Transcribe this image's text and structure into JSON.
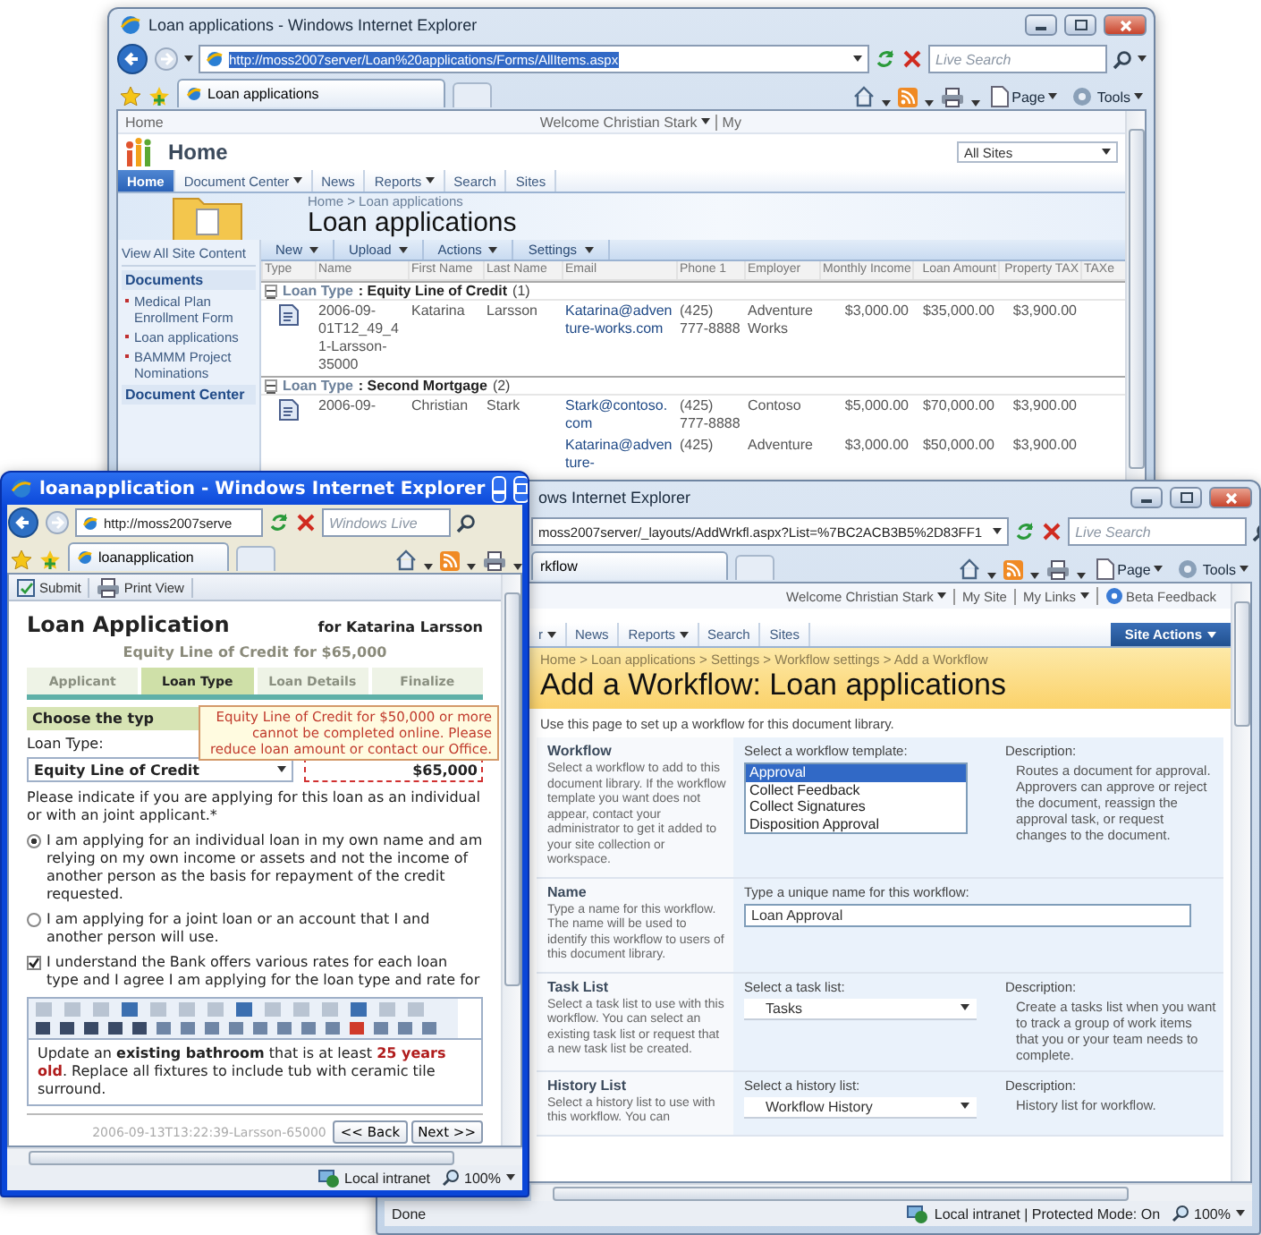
{
  "list_window": {
    "title": "Loan applications - Windows Internet Explorer",
    "address": "http://moss2007server/Loan%20applications/Forms/AllItems.aspx",
    "search_placeholder": "Live Search",
    "tab": "Loan applications",
    "commands": [
      "Page",
      "Tools"
    ],
    "top_link": "Home",
    "welcome": "Welcome Christian Stark",
    "my_link": "My",
    "site_title": "Home",
    "scope": "All Sites",
    "nav": [
      {
        "label": "Home",
        "selected": true,
        "menu": false
      },
      {
        "label": "Document Center",
        "selected": false,
        "menu": true
      },
      {
        "label": "News",
        "selected": false,
        "menu": false
      },
      {
        "label": "Reports",
        "selected": false,
        "menu": true
      },
      {
        "label": "Search",
        "selected": false,
        "menu": false
      },
      {
        "label": "Sites",
        "selected": false,
        "menu": false
      }
    ],
    "breadcrumb": "Home > Loan applications",
    "page_title": "Loan applications",
    "quick_launch": {
      "view_all": "View All Site Content",
      "sections": [
        {
          "heading": "Documents",
          "items": [
            "Medical Plan Enrollment Form",
            "Loan applications",
            "BAMMM Project Nominations"
          ]
        },
        {
          "heading": "Document Center"
        }
      ]
    },
    "list_toolbar": [
      "New",
      "Upload",
      "Actions",
      "Settings"
    ],
    "columns": [
      "Type",
      "Name",
      "First Name",
      "Last Name",
      "Email",
      "Phone 1",
      "Employer",
      "Monthly Income",
      "Loan Amount",
      "Property TAX",
      "TAXe"
    ],
    "groups": [
      {
        "field": "Loan Type",
        "value": ": Equity Line of Credit",
        "count": "(1)",
        "rows": [
          {
            "type_icon": true,
            "cells": [
              "2006-09-01T12_49_41-Larsson-35000",
              "Katarina",
              "Larsson",
              "Katarina@adventure-works.com",
              "(425) 777-8888",
              "Adventure Works",
              "$3,000.00",
              "$35,000.00",
              "$3,900.00"
            ]
          }
        ]
      },
      {
        "field": "Loan Type",
        "value": ": Second Mortgage",
        "count": "(2)",
        "rows": [
          {
            "type_icon": true,
            "cells": [
              "2006-09-",
              "Christian",
              "Stark",
              "Stark@contoso.com",
              "(425) 777-8888",
              "Contoso",
              "$5,000.00",
              "$70,000.00",
              "$3,900.00"
            ]
          },
          {
            "type_icon": false,
            "cells": [
              null,
              null,
              null,
              "Katarina@adventure-",
              "(425)",
              "Adventure",
              "$3,000.00",
              "$50,000.00",
              "$3,900.00"
            ]
          }
        ]
      }
    ]
  },
  "workflow_window": {
    "title": "ows Internet Explorer",
    "address": "moss2007server/_layouts/AddWrkfl.aspx?List=%7BC2ACB3B5%2D83FF1",
    "search_placeholder": "Live Search",
    "tab": "rkflow",
    "commands": [
      "Page",
      "Tools"
    ],
    "top_links": [
      {
        "label": "Welcome Christian Stark",
        "menu": true
      },
      {
        "label": "My Site",
        "menu": false
      },
      {
        "label": "My Links",
        "menu": true
      },
      {
        "label": "Beta Feedback",
        "menu": false
      }
    ],
    "nav": [
      {
        "label": "r",
        "menu": true,
        "selected": false
      },
      {
        "label": "News",
        "menu": false,
        "selected": false
      },
      {
        "label": "Reports",
        "menu": true,
        "selected": false
      },
      {
        "label": "Search",
        "menu": false,
        "selected": false
      },
      {
        "label": "Sites",
        "menu": false,
        "selected": false
      }
    ],
    "site_actions": "Site Actions",
    "breadcrumb": "Home > Loan applications > Settings > Workflow settings > Add a Workflow",
    "page_title": "Add a Workflow: Loan applications",
    "intro": "Use this page to set up a workflow for this document library.",
    "sections": [
      {
        "kind": "listbox",
        "title": "Workflow",
        "help": "Select a workflow to add to this document library. If the workflow template you want does not appear, contact your administrator to get it added to your site collection or workspace.",
        "field_label": "Select a workflow template:",
        "options": [
          {
            "label": "Approval",
            "selected": true
          },
          {
            "label": "Collect Feedback",
            "selected": false
          },
          {
            "label": "Collect Signatures",
            "selected": false
          },
          {
            "label": "Disposition Approval",
            "selected": false
          }
        ],
        "description_label": "Description:",
        "description": "Routes a document for approval. Approvers can approve or reject the document, reassign the approval task, or request changes to the document."
      },
      {
        "kind": "text",
        "title": "Name",
        "help": "Type a name for this workflow. The name will be used to identify this workflow to users of this document library.",
        "field_label": "Type a unique name for this workflow:",
        "value": "Loan Approval"
      },
      {
        "kind": "select",
        "title": "Task List",
        "help": "Select a task list to use with this workflow. You can select an existing task list or request that a new task list be created.",
        "field_label": "Select a task list:",
        "value": "Tasks",
        "description_label": "Description:",
        "description": "Create a tasks list when you want to track a group of work items that you or your team needs to complete."
      },
      {
        "kind": "select",
        "title": "History List",
        "help": "Select a history list to use with this workflow. You can",
        "field_label": "Select a history list:",
        "value": "Workflow History",
        "description_label": "Description:",
        "description": "History list for workflow."
      }
    ],
    "status": "Done",
    "zone": "Local intranet | Protected Mode: On",
    "zoom": "100%"
  },
  "form_window": {
    "title": "loanapplication - Windows Internet Explorer",
    "address": "http://moss2007serve",
    "search_placeholder": "Windows Live",
    "tab": "loanapplication",
    "actions": [
      "Submit",
      "Print View"
    ],
    "heading": "Loan Application",
    "applicant": "for Katarina Larsson",
    "summary": "Equity Line of Credit  for  $65,000",
    "steps": [
      {
        "label": "Applicant",
        "selected": false
      },
      {
        "label": "Loan Type",
        "selected": true
      },
      {
        "label": "Loan Details",
        "selected": false
      },
      {
        "label": "Finalize",
        "selected": false
      }
    ],
    "section": "Choose the typ",
    "tooltip": "Equity Line of Credit for $50,000 or more cannot be completed online. Please reduce loan amount or contact our Office.",
    "loan_type_label": "Loan Type:",
    "loan_type": "Equity Line of Credit",
    "amount": {
      "value": "$65,000",
      "invalid": true
    },
    "question": "Please indicate if you are applying for this loan as an individual or with an joint applicant.*",
    "options": [
      {
        "label": "I am applying for an individual loan in my own name and am relying on my own income or assets and not the income of another person as the basis for repayment of the credit requested.",
        "selected": true
      },
      {
        "label": "I am applying for a joint loan or an account that I and another person will use.",
        "selected": false
      }
    ],
    "agreement": {
      "label": "I understand the Bank offers various rates for each loan type and I agree I am applying for the loan type and rate for",
      "checked": true
    },
    "notes": [
      {
        "kind": "plain",
        "text": "Update an "
      },
      {
        "kind": "bold",
        "text": "existing bathroom"
      },
      {
        "kind": "plain",
        "text": " that is at least "
      },
      {
        "kind": "alert",
        "text": "25 years old"
      },
      {
        "kind": "plain",
        "text": ". Replace all fixtures to include tub with ceramic tile surround."
      }
    ],
    "stamp": "2006-09-13T13:22:39-Larsson-65000",
    "buttons": [
      "<< Back",
      "Next >>"
    ],
    "zone": "Local intranet",
    "zoom": "100%"
  }
}
